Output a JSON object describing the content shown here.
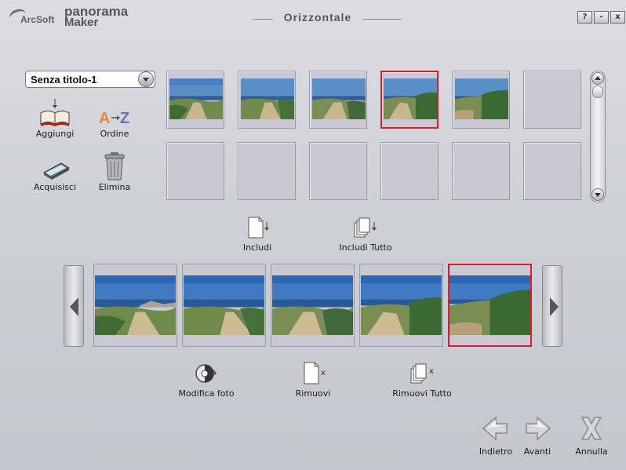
{
  "window": {
    "brand_small": "ArcSoft",
    "brand_line1": "panorama",
    "brand_line2": "Maker",
    "title": "Orizzontale",
    "help_label": "?",
    "minimize_label": "-",
    "close_label": "x"
  },
  "project": {
    "selected": "Senza titolo-1"
  },
  "tools": {
    "add": "Aggiungi",
    "order": "Ordine",
    "acquire": "Acquisisci",
    "delete": "Elimina"
  },
  "library": {
    "thumbnails_filled": 5,
    "selected_index": 3,
    "slots": 12
  },
  "actions": {
    "include": "Includi",
    "include_all": "Includi Tutto",
    "edit_photo": "Modifica foto",
    "remove": "Rimuovi",
    "remove_all": "Rimuovi Tutto"
  },
  "strip": {
    "count": 5,
    "selected_index": 4
  },
  "footer": {
    "back": "Indietro",
    "next": "Avanti",
    "cancel": "Annulla"
  },
  "colors": {
    "selection": "#d81e26",
    "background": "#cfcfd6"
  }
}
